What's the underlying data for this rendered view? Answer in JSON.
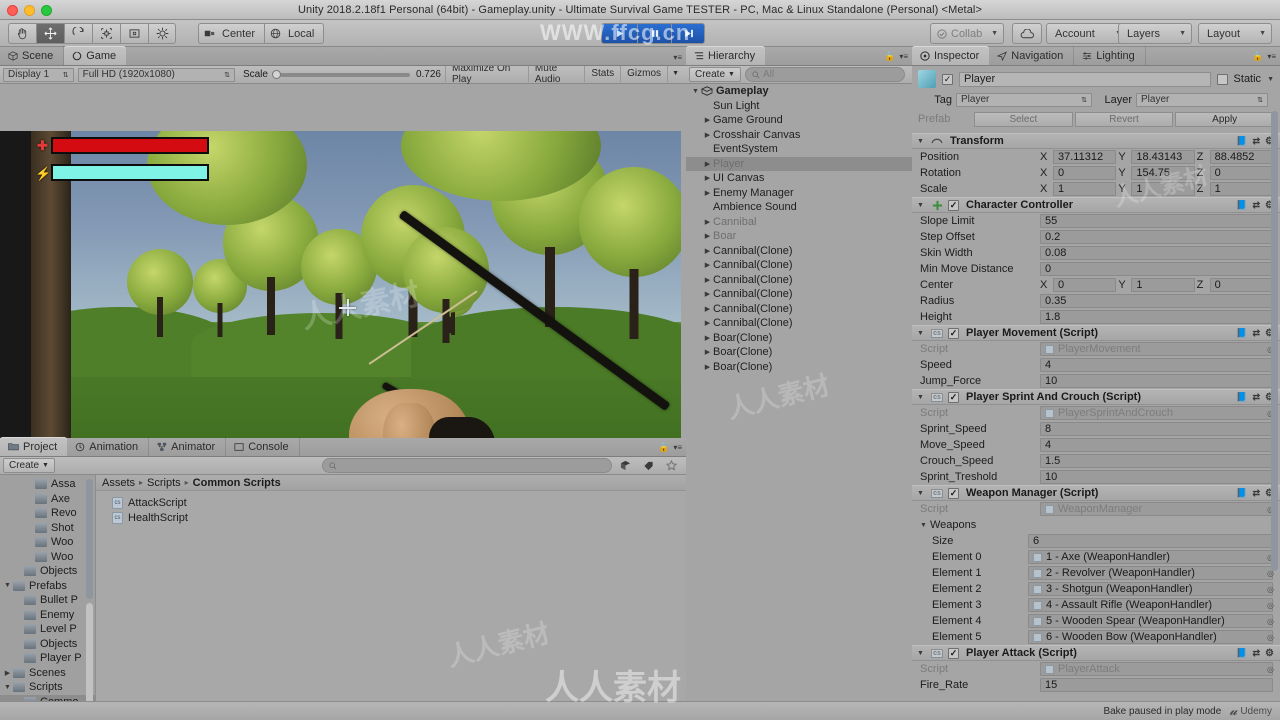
{
  "window": {
    "title": "Unity 2018.2.18f1 Personal (64bit) - Gameplay.unity - Ultimate Survival Game TESTER - PC, Mac & Linux Standalone (Personal) <Metal>"
  },
  "toolbar": {
    "transform_tools": [
      {
        "name": "hand-tool",
        "active": false
      },
      {
        "name": "move-tool",
        "active": true
      },
      {
        "name": "rotate-tool",
        "active": false
      },
      {
        "name": "scale-tool",
        "active": false
      },
      {
        "name": "rect-tool",
        "active": false
      },
      {
        "name": "transform-tool",
        "active": false
      }
    ],
    "pivot_label": "Center",
    "space_label": "Local",
    "play_label": "play-icon",
    "pause_label": "pause-icon",
    "step_label": "step-icon",
    "collab_label": "Collab",
    "cloud_label": "cloud-icon",
    "account_label": "Account",
    "layers_label": "Layers",
    "layout_label": "Layout"
  },
  "gameview": {
    "tabs": [
      {
        "label": "Scene",
        "icon": "scene-icon",
        "active": false
      },
      {
        "label": "Game",
        "icon": "game-icon",
        "active": true
      }
    ],
    "display_label": "Display 1",
    "aspect_label": "Full HD (1920x1080)",
    "scale_label": "Scale",
    "scale_value": "0.726",
    "maximize_label": "Maximize On Play",
    "mute_label": "Mute Audio",
    "stats_label": "Stats",
    "gizmos_label": "Gizmos",
    "hud": {
      "health_icon": "health-cross-icon",
      "stamina_icon": "stamina-bolt-icon",
      "health_color": "#d40c12",
      "stamina_color": "#7ff3e6",
      "health_percent": 100,
      "stamina_percent": 100
    },
    "crosshair": "crosshair-icon"
  },
  "hierarchy": {
    "tab_label": "Hierarchy",
    "create_label": "Create",
    "search_placeholder": "All",
    "items": [
      {
        "label": "Gameplay",
        "depth": 0,
        "arrow": "down",
        "bold": true,
        "selected": false,
        "dim": false
      },
      {
        "label": "Sun Light",
        "depth": 1,
        "arrow": "none",
        "bold": false,
        "selected": false,
        "dim": false
      },
      {
        "label": "Game Ground",
        "depth": 1,
        "arrow": "right",
        "bold": false,
        "selected": false,
        "dim": false
      },
      {
        "label": "Crosshair Canvas",
        "depth": 1,
        "arrow": "right",
        "bold": false,
        "selected": false,
        "dim": false
      },
      {
        "label": "EventSystem",
        "depth": 1,
        "arrow": "none",
        "bold": false,
        "selected": false,
        "dim": false
      },
      {
        "label": "Player",
        "depth": 1,
        "arrow": "right",
        "bold": false,
        "selected": true,
        "dim": true
      },
      {
        "label": "UI Canvas",
        "depth": 1,
        "arrow": "right",
        "bold": false,
        "selected": false,
        "dim": false
      },
      {
        "label": "Enemy Manager",
        "depth": 1,
        "arrow": "right",
        "bold": false,
        "selected": false,
        "dim": false
      },
      {
        "label": "Ambience Sound",
        "depth": 1,
        "arrow": "none",
        "bold": false,
        "selected": false,
        "dim": false
      },
      {
        "label": "Cannibal",
        "depth": 1,
        "arrow": "right",
        "bold": false,
        "selected": false,
        "dim": true
      },
      {
        "label": "Boar",
        "depth": 1,
        "arrow": "right",
        "bold": false,
        "selected": false,
        "dim": true
      },
      {
        "label": "Cannibal(Clone)",
        "depth": 1,
        "arrow": "right",
        "bold": false,
        "selected": false,
        "dim": false
      },
      {
        "label": "Cannibal(Clone)",
        "depth": 1,
        "arrow": "right",
        "bold": false,
        "selected": false,
        "dim": false
      },
      {
        "label": "Cannibal(Clone)",
        "depth": 1,
        "arrow": "right",
        "bold": false,
        "selected": false,
        "dim": false
      },
      {
        "label": "Cannibal(Clone)",
        "depth": 1,
        "arrow": "right",
        "bold": false,
        "selected": false,
        "dim": false
      },
      {
        "label": "Cannibal(Clone)",
        "depth": 1,
        "arrow": "right",
        "bold": false,
        "selected": false,
        "dim": false
      },
      {
        "label": "Cannibal(Clone)",
        "depth": 1,
        "arrow": "right",
        "bold": false,
        "selected": false,
        "dim": false
      },
      {
        "label": "Boar(Clone)",
        "depth": 1,
        "arrow": "right",
        "bold": false,
        "selected": false,
        "dim": false
      },
      {
        "label": "Boar(Clone)",
        "depth": 1,
        "arrow": "right",
        "bold": false,
        "selected": false,
        "dim": false
      },
      {
        "label": "Boar(Clone)",
        "depth": 1,
        "arrow": "right",
        "bold": false,
        "selected": false,
        "dim": false
      }
    ]
  },
  "inspector": {
    "tabs": [
      {
        "label": "Inspector",
        "icon": "inspector-icon",
        "active": true
      },
      {
        "label": "Navigation",
        "icon": "navigation-icon",
        "active": false
      },
      {
        "label": "Lighting",
        "icon": "lighting-icon",
        "active": false
      }
    ],
    "object_name": "Player",
    "object_enabled": true,
    "static_label": "Static",
    "tag_label": "Tag",
    "tag_value": "Player",
    "layer_label": "Layer",
    "layer_value": "Player",
    "prefab_label": "Prefab",
    "select_label": "Select",
    "revert_label": "Revert",
    "apply_label": "Apply",
    "components": [
      {
        "title": "Transform",
        "icon": "transform-icon",
        "has_checkbox": false,
        "enabled": true,
        "rows": [
          {
            "type": "vector3",
            "label": "Position",
            "x": "37.11312",
            "y": "18.43143",
            "z": "88.4852"
          },
          {
            "type": "vector3",
            "label": "Rotation",
            "x": "0",
            "y": "154.75",
            "z": "0"
          },
          {
            "type": "vector3",
            "label": "Scale",
            "x": "1",
            "y": "1",
            "z": "1"
          }
        ]
      },
      {
        "title": "Character Controller",
        "icon": "character-controller-icon",
        "has_checkbox": true,
        "enabled": true,
        "rows": [
          {
            "type": "field",
            "label": "Slope Limit",
            "value": "55"
          },
          {
            "type": "field",
            "label": "Step Offset",
            "value": "0.2"
          },
          {
            "type": "field",
            "label": "Skin Width",
            "value": "0.08"
          },
          {
            "type": "field",
            "label": "Min Move Distance",
            "value": "0"
          },
          {
            "type": "vector3",
            "label": "Center",
            "x": "0",
            "y": "1",
            "z": "0"
          },
          {
            "type": "field",
            "label": "Radius",
            "value": "0.35"
          },
          {
            "type": "field",
            "label": "Height",
            "value": "1.8"
          }
        ]
      },
      {
        "title": "Player Movement (Script)",
        "icon": "script-icon",
        "has_checkbox": true,
        "enabled": true,
        "rows": [
          {
            "type": "object",
            "label": "Script",
            "value": "PlayerMovement",
            "disabled": true
          },
          {
            "type": "field",
            "label": "Speed",
            "value": "4"
          },
          {
            "type": "field",
            "label": "Jump_Force",
            "value": "10"
          }
        ]
      },
      {
        "title": "Player Sprint And Crouch (Script)",
        "icon": "script-icon",
        "has_checkbox": true,
        "enabled": true,
        "rows": [
          {
            "type": "object",
            "label": "Script",
            "value": "PlayerSprintAndCrouch",
            "disabled": true
          },
          {
            "type": "field",
            "label": "Sprint_Speed",
            "value": "8"
          },
          {
            "type": "field",
            "label": "Move_Speed",
            "value": "4"
          },
          {
            "type": "field",
            "label": "Crouch_Speed",
            "value": "1.5"
          },
          {
            "type": "field",
            "label": "Sprint_Treshold",
            "value": "10"
          }
        ]
      },
      {
        "title": "Weapon Manager (Script)",
        "icon": "script-icon",
        "has_checkbox": true,
        "enabled": true,
        "rows": [
          {
            "type": "object",
            "label": "Script",
            "value": "WeaponManager",
            "disabled": true
          },
          {
            "type": "foldout",
            "label": "Weapons"
          },
          {
            "type": "field",
            "label": "Size",
            "value": "6",
            "indent": true
          },
          {
            "type": "object",
            "label": "Element 0",
            "value": "1 - Axe (WeaponHandler)",
            "indent": true
          },
          {
            "type": "object",
            "label": "Element 1",
            "value": "2 - Revolver (WeaponHandler)",
            "indent": true
          },
          {
            "type": "object",
            "label": "Element 2",
            "value": "3 - Shotgun (WeaponHandler)",
            "indent": true
          },
          {
            "type": "object",
            "label": "Element 3",
            "value": "4 - Assault Rifle (WeaponHandler)",
            "indent": true
          },
          {
            "type": "object",
            "label": "Element 4",
            "value": "5 - Wooden Spear (WeaponHandler)",
            "indent": true
          },
          {
            "type": "object",
            "label": "Element 5",
            "value": "6 - Wooden Bow (WeaponHandler)",
            "indent": true
          }
        ]
      },
      {
        "title": "Player Attack (Script)",
        "icon": "script-icon",
        "has_checkbox": true,
        "enabled": true,
        "rows": [
          {
            "type": "object",
            "label": "Script",
            "value": "PlayerAttack",
            "disabled": true
          },
          {
            "type": "field",
            "label": "Fire_Rate",
            "value": "15"
          }
        ]
      }
    ]
  },
  "project": {
    "tabs": [
      {
        "label": "Project",
        "icon": "project-icon",
        "active": true
      },
      {
        "label": "Animation",
        "icon": "animation-icon",
        "active": false
      },
      {
        "label": "Animator",
        "icon": "animator-icon",
        "active": false
      },
      {
        "label": "Console",
        "icon": "console-icon",
        "active": false
      }
    ],
    "create_label": "Create",
    "search_placeholder": "",
    "tree": [
      {
        "label": "Assa",
        "depth": 2,
        "arrow": "none",
        "selected": false
      },
      {
        "label": "Axe",
        "depth": 2,
        "arrow": "none",
        "selected": false
      },
      {
        "label": "Revo",
        "depth": 2,
        "arrow": "none",
        "selected": false
      },
      {
        "label": "Shot",
        "depth": 2,
        "arrow": "none",
        "selected": false
      },
      {
        "label": "Woo",
        "depth": 2,
        "arrow": "none",
        "selected": false
      },
      {
        "label": "Woo",
        "depth": 2,
        "arrow": "none",
        "selected": false
      },
      {
        "label": "Objects",
        "depth": 1,
        "arrow": "none",
        "selected": false
      },
      {
        "label": "Prefabs",
        "depth": 0,
        "arrow": "down",
        "selected": false
      },
      {
        "label": "Bullet P",
        "depth": 1,
        "arrow": "none",
        "selected": false
      },
      {
        "label": "Enemy",
        "depth": 1,
        "arrow": "none",
        "selected": false
      },
      {
        "label": "Level P",
        "depth": 1,
        "arrow": "none",
        "selected": false
      },
      {
        "label": "Objects",
        "depth": 1,
        "arrow": "none",
        "selected": false
      },
      {
        "label": "Player P",
        "depth": 1,
        "arrow": "none",
        "selected": false
      },
      {
        "label": "Scenes",
        "depth": 0,
        "arrow": "right",
        "selected": false
      },
      {
        "label": "Scripts",
        "depth": 0,
        "arrow": "down",
        "selected": false
      },
      {
        "label": "Commo",
        "depth": 1,
        "arrow": "none",
        "selected": true
      }
    ],
    "breadcrumb": [
      "Assets",
      "Scripts",
      "Common Scripts"
    ],
    "assets": [
      {
        "label": "AttackScript",
        "icon": "cs-script-icon"
      },
      {
        "label": "HealthScript",
        "icon": "cs-script-icon"
      }
    ]
  },
  "statusbar": {
    "message": "Bake paused in play mode",
    "brand": "Udemy"
  },
  "watermarks": {
    "top": "WWW.ffcg.cn",
    "bottom": "人人素材"
  },
  "colors": {
    "accent_blue": "#2b6fd0",
    "panel_bg": "#a5a5a5",
    "chrome": "#bcbcbc",
    "health": "#d40c12",
    "stamina": "#7ff3e6"
  }
}
